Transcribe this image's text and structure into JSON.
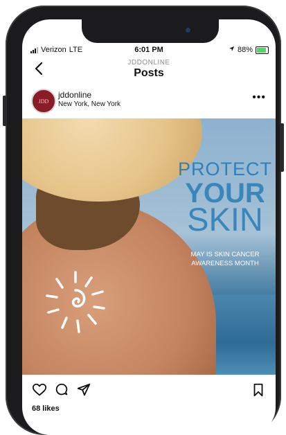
{
  "status_bar": {
    "carrier": "Verizon",
    "network": "LTE",
    "time": "6:01 PM",
    "battery": "88%",
    "battery_level": 0.88,
    "signal_bars": 3
  },
  "header": {
    "account": "JDDONLINE",
    "title": "Posts"
  },
  "post": {
    "username": "jddonline",
    "location": "New York, New York",
    "avatar_text": "JDD",
    "image": {
      "line1": "PROTECT",
      "line2": "YOUR",
      "line3": "SKIN",
      "tagline": "MAY IS SKIN CANCER AWARENESS MONTH"
    },
    "likes": "68 likes"
  },
  "icons": {
    "back": "chevron-left-icon",
    "more": "more-dots-icon",
    "like": "heart-icon",
    "comment": "comment-icon",
    "share": "send-icon",
    "save": "bookmark-icon"
  },
  "colors": {
    "text_blue": "#3a86bb",
    "battery_green": "#4cd964"
  }
}
